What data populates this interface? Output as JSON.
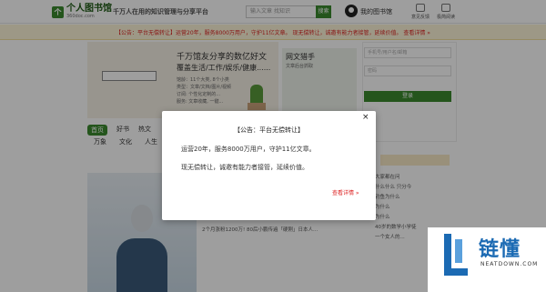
{
  "header": {
    "logo_text": "个人图书馆",
    "logo_sub": "360doc.com",
    "slogan": "千万人在用的知识管理与分享平台",
    "search_placeholder": "输入文章 找知识",
    "search_button": "搜索",
    "my_library": "我的图书馆",
    "buttons": [
      "意见反馈",
      "极简阅读"
    ]
  },
  "notice_bar": {
    "text": "【公告：平台无偿转让】运营20年，服务8000万用户，守护11亿文章。 现无偿转让，诚邀有能力者接管，延续价值。 查看详情 »"
  },
  "page": {
    "hero_title": "千万馆友分享的数亿好文",
    "hero_sub": "覆盖生活/工作/娱乐/健康......",
    "hero_stats": [
      "馆龄：11个大类, 8个小类",
      "类型：文章/文档/图片/视频",
      "订阅: 个性化定制的...",
      "服务: 文章收藏, 一键..."
    ],
    "feature_title": "网文猎手",
    "feature_sub": "文章后台抓取",
    "login_fields": [
      "手机号/用户名/邮箱",
      "密码"
    ],
    "login_button": "登录",
    "tabs": [
      "首页",
      "好书",
      "热文"
    ],
    "tabs2": [
      "万象",
      "文化",
      "人生"
    ],
    "article_text": "2个月涨粉1200万! 80后小鹏传遍「硬刚」日本人...",
    "side_list": [
      "大家都在问",
      "什么什么 只分今",
      "钓鱼为什么",
      "为什么",
      "为什么",
      "40岁的数学小学徒",
      "一个女人的..."
    ]
  },
  "modal": {
    "title": "【公告：平台无偿转让】",
    "close": "×",
    "line1": "运营20年，服务8000万用户，守护11亿文章。",
    "line2": "现无偿转让，诚邀有能力者接管，延续价值。",
    "link": "查看详情 »"
  },
  "watermark": {
    "brand": "链懂",
    "domain": "NEATDOWN.COM"
  }
}
